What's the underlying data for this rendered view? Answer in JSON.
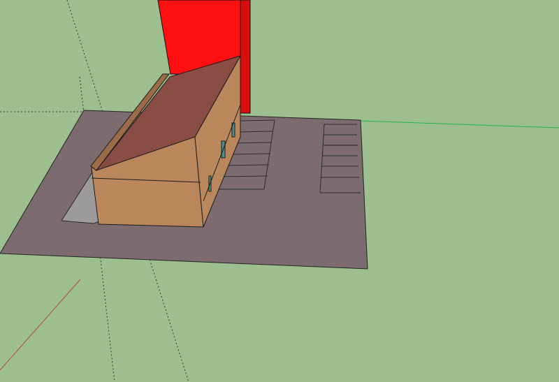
{
  "viewport": {
    "background_color": "#9dbe8f",
    "ground_plane_color": "#7c6b6f",
    "axis_green_color": "#22b84b",
    "axis_red_color": "#b44a4a",
    "guide_line_color": "#2b3a2b",
    "roof_color": "#8a4d43",
    "brick_color": "#b9875b",
    "red_panel_color": "#ff1010",
    "red_panel_side_color": "#d90d0d",
    "window_color": "#4d8f8c",
    "hatch_color": "#9c9a9a"
  },
  "scene_objects": {
    "ground_plane": "ground-plane",
    "building": "building",
    "red_panel": "red-panel",
    "parking_stripes": "parking-stripes"
  }
}
